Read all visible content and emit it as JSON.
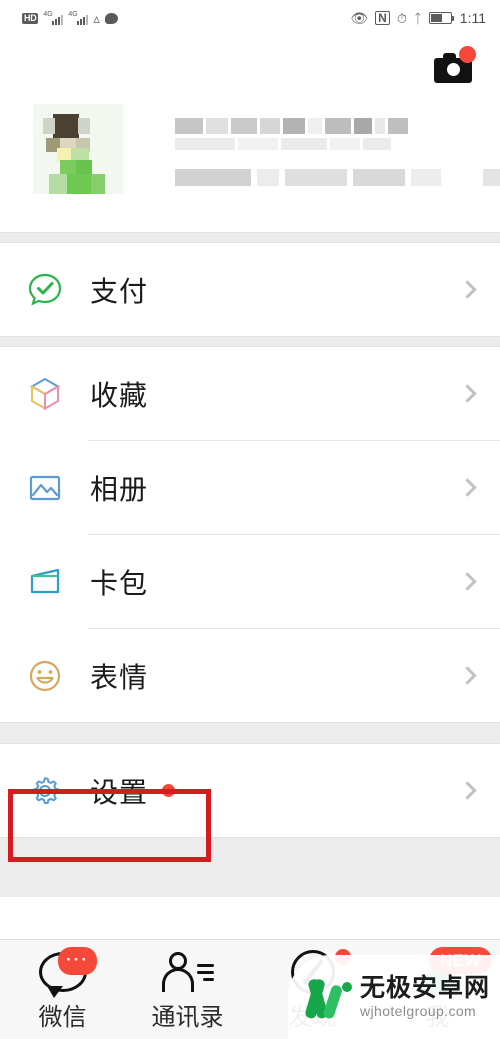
{
  "status_bar": {
    "hd_label": "HD",
    "network_1": "4G",
    "network_2": "4G",
    "icons": [
      "hd-badge",
      "signal-bars-1",
      "signal-bars-2",
      "wifi-icon",
      "chat-bubble-icon",
      "eye-care-icon",
      "nfc-icon",
      "alarm-icon",
      "bluetooth-icon",
      "battery-icon"
    ],
    "time": "1:11"
  },
  "header": {
    "camera_icon": "camera-icon",
    "camera_has_badge": true
  },
  "profile": {
    "avatar": "user-avatar-blurred",
    "nickname": "",
    "wechat_id": "",
    "obscured": true
  },
  "sections": [
    {
      "id": "pay-section",
      "items": [
        {
          "key": "pay",
          "label": "支付",
          "icon": "pay-icon",
          "icon_color": "#2bb44a",
          "badge": false
        }
      ]
    },
    {
      "id": "services-section",
      "items": [
        {
          "key": "favorites",
          "label": "收藏",
          "icon": "favorites-cube-icon",
          "icon_color": "#5b9bd5",
          "badge": false
        },
        {
          "key": "album",
          "label": "相册",
          "icon": "album-photo-icon",
          "icon_color": "#5b9bd5",
          "badge": false
        },
        {
          "key": "cards",
          "label": "卡包",
          "icon": "card-wallet-icon",
          "icon_color": "#2e9ec4",
          "badge": false
        },
        {
          "key": "emoji",
          "label": "表情",
          "icon": "emoji-smiley-icon",
          "icon_color": "#d5a95b",
          "badge": false
        }
      ]
    },
    {
      "id": "settings-section",
      "items": [
        {
          "key": "settings",
          "label": "设置",
          "icon": "settings-gear-icon",
          "icon_color": "#5b9bd5",
          "badge": true
        }
      ]
    }
  ],
  "annotation": {
    "target": "settings-row",
    "color": "#d71920",
    "shape": "rectangle"
  },
  "tabbar": {
    "items": [
      {
        "key": "wechat",
        "label": "微信",
        "icon": "chat-bubble-icon",
        "active": false,
        "badge": "···",
        "badge_type": "pill"
      },
      {
        "key": "contacts",
        "label": "通讯录",
        "icon": "contacts-icon",
        "active": false,
        "badge": null,
        "badge_type": null
      },
      {
        "key": "discover",
        "label": "发现",
        "icon": "compass-icon",
        "active": false,
        "badge": "",
        "badge_type": "dot"
      },
      {
        "key": "me",
        "label": "我",
        "icon": "person-icon",
        "active": true,
        "badge": "NEW",
        "badge_type": "pill"
      }
    ],
    "active_color": "#19b051",
    "badge_color": "#f5483b"
  },
  "watermark": {
    "site_cn": "无极安卓网",
    "site_url": "wjhotelgroup.com",
    "logo_color": "#17a74a"
  }
}
